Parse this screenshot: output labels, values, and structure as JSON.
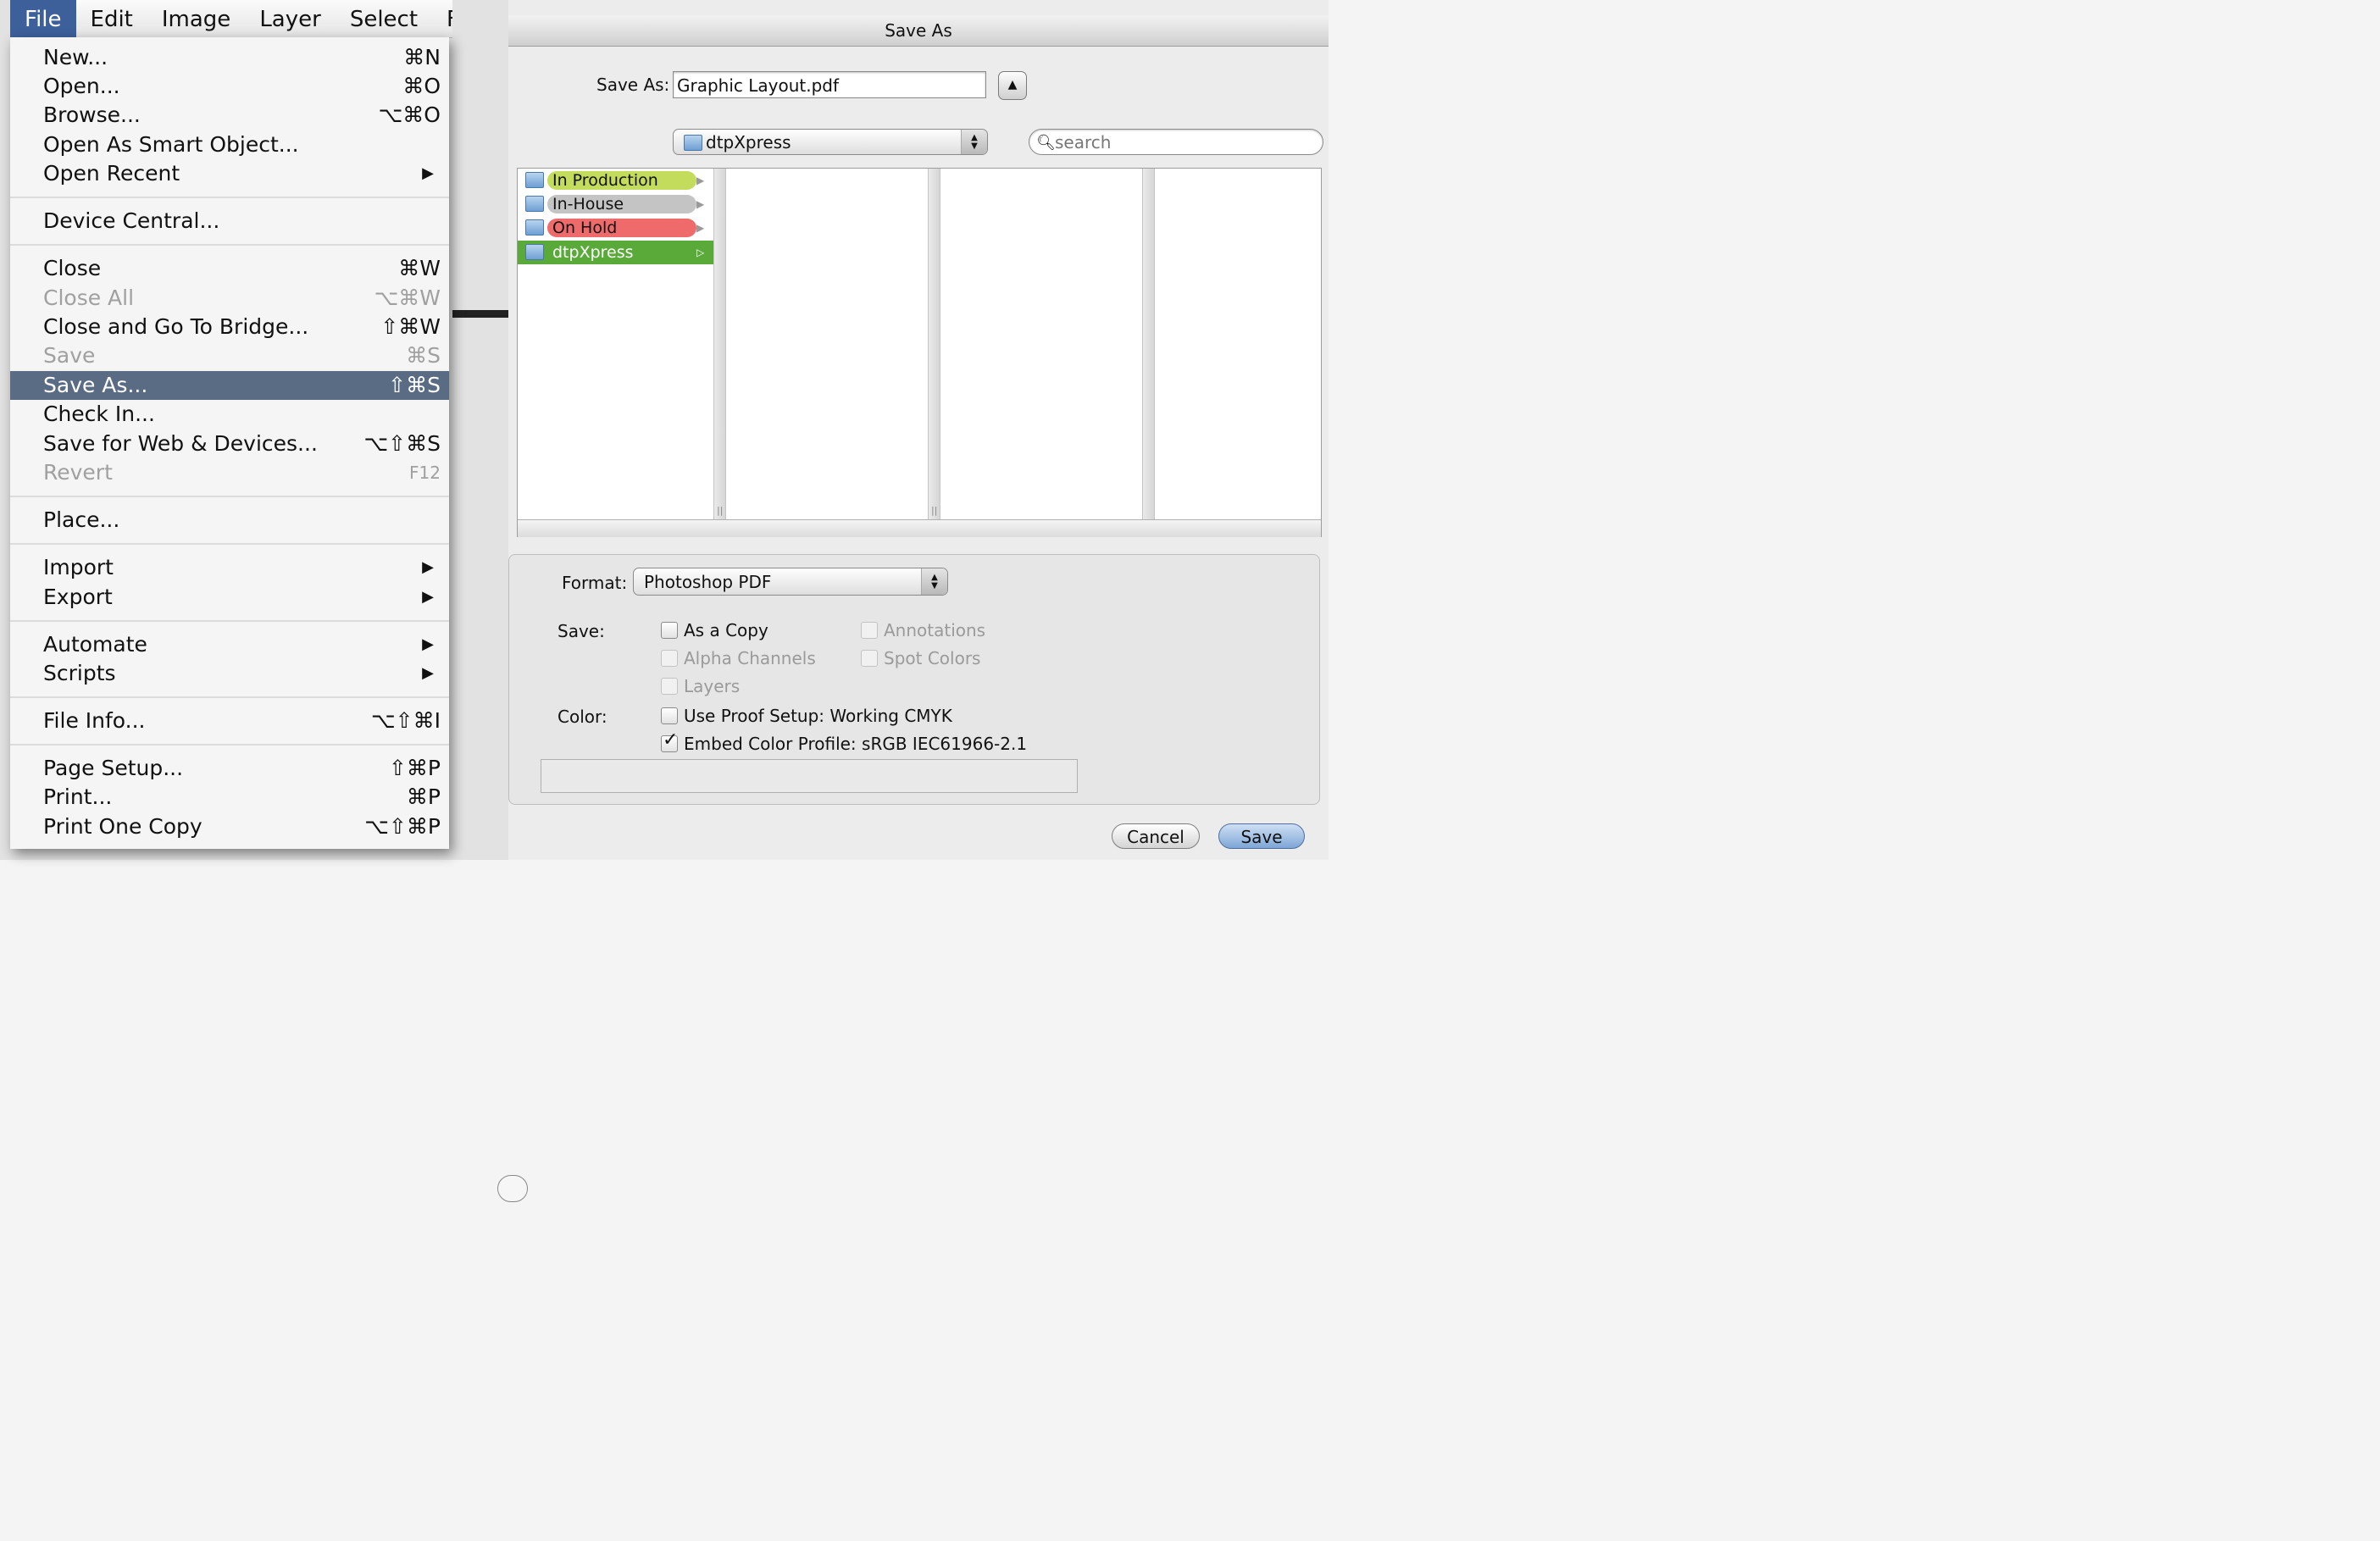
{
  "menubar": {
    "items": [
      "File",
      "Edit",
      "Image",
      "Layer",
      "Select",
      "Filt"
    ]
  },
  "file_menu": {
    "items": [
      {
        "label": "New...",
        "shortcut": "⌘N"
      },
      {
        "label": "Open...",
        "shortcut": "⌘O"
      },
      {
        "label": "Browse...",
        "shortcut": "⌥⌘O"
      },
      {
        "label": "Open As Smart Object...",
        "shortcut": ""
      },
      {
        "label": "Open Recent",
        "shortcut": ""
      },
      {
        "label": "Device Central...",
        "shortcut": ""
      },
      {
        "label": "Close",
        "shortcut": "⌘W"
      },
      {
        "label": "Close All",
        "shortcut": "⌥⌘W"
      },
      {
        "label": "Close and Go To Bridge...",
        "shortcut": "⇧⌘W"
      },
      {
        "label": "Save",
        "shortcut": "⌘S"
      },
      {
        "label": "Save As...",
        "shortcut": "⇧⌘S"
      },
      {
        "label": "Check In...",
        "shortcut": ""
      },
      {
        "label": "Save for Web & Devices...",
        "shortcut": "⌥⇧⌘S"
      },
      {
        "label": "Revert",
        "shortcut": "F12"
      },
      {
        "label": "Place...",
        "shortcut": ""
      },
      {
        "label": "Import",
        "shortcut": ""
      },
      {
        "label": "Export",
        "shortcut": ""
      },
      {
        "label": "Automate",
        "shortcut": ""
      },
      {
        "label": "Scripts",
        "shortcut": ""
      },
      {
        "label": "File Info...",
        "shortcut": "⌥⇧⌘I"
      },
      {
        "label": "Page Setup...",
        "shortcut": "⇧⌘P"
      },
      {
        "label": "Print...",
        "shortcut": "⌘P"
      },
      {
        "label": "Print One Copy",
        "shortcut": "⌥⇧⌘P"
      }
    ],
    "submenu_arrow": "▶"
  },
  "dialog": {
    "title": "Save As",
    "save_as_label": "Save As:",
    "filename": "Graphic Layout.pdf",
    "expand_arrow": "▲",
    "location": "dtpXpress",
    "search_placeholder": "search",
    "sidebar": [
      {
        "label": "In Production",
        "color": "#c3dc5c"
      },
      {
        "label": "In-House",
        "color": "#c4c4c4"
      },
      {
        "label": "On Hold",
        "color": "#ef6b6b"
      },
      {
        "label": "dtpXpress",
        "color": "#5aaa3a"
      }
    ],
    "row_arrow": "▶",
    "selected_arrow": "▷",
    "format_label": "Format:",
    "format_value": "Photoshop PDF",
    "save_label": "Save:",
    "save_options": {
      "as_a_copy": "As a Copy",
      "alpha_channels": "Alpha Channels",
      "layers": "Layers",
      "annotations": "Annotations",
      "spot_colors": "Spot Colors"
    },
    "color_label": "Color:",
    "color_options": {
      "use_proof_setup": "Use Proof Setup:  Working CMYK",
      "embed_color_profile": "Embed Color Profile:  sRGB IEC61966-2.1"
    },
    "cancel": "Cancel",
    "save": "Save"
  },
  "icons": {
    "search": "search-icon",
    "folder": "folder-icon",
    "checkmark": "checkmark-icon"
  },
  "colors": {
    "menu_highlight": "#5a6b84",
    "menubar_active": "#3d5f9a",
    "selected_row": "#5aaa3a"
  }
}
